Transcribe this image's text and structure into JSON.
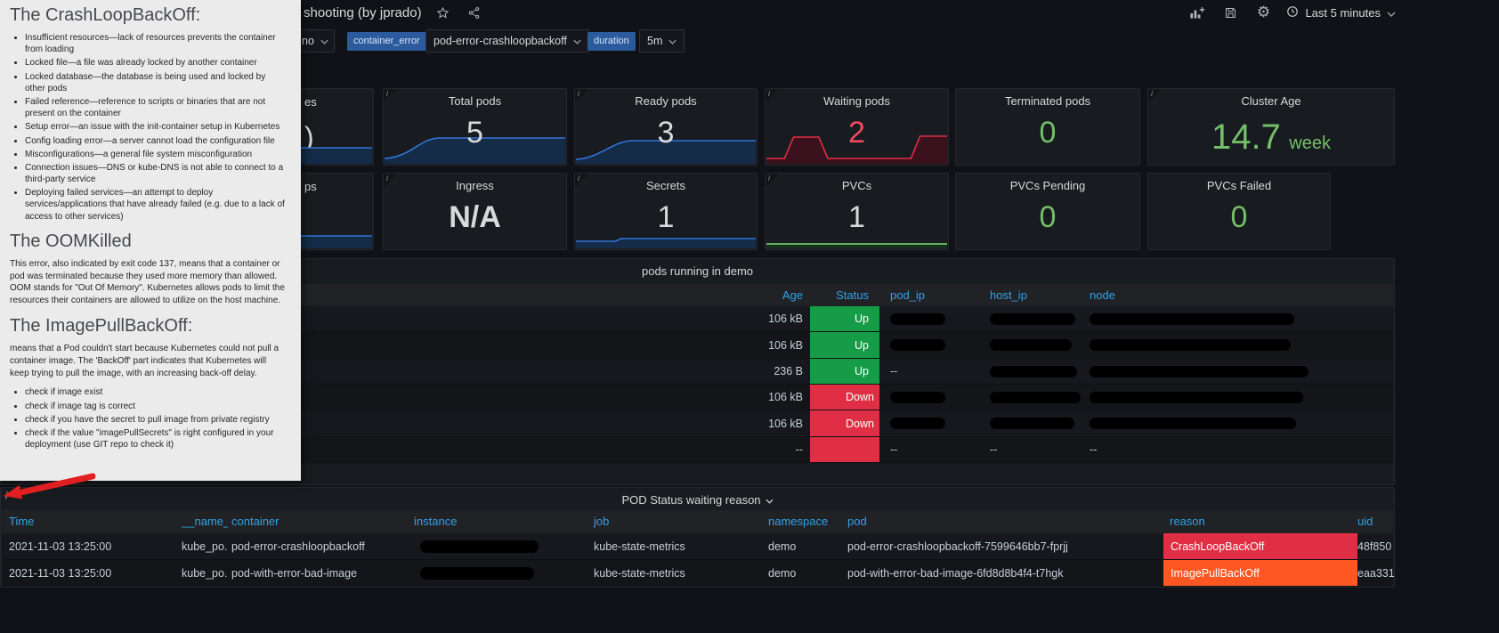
{
  "topbar": {
    "title_fragment": "shooting (by jprado)",
    "time_range": "Last 5 minutes"
  },
  "filter_bar": {
    "namespace_fragment": "no",
    "container_error_label": "container_error",
    "pod_filter_value": "pod-error-crashloopbackoff",
    "duration_label": "duration",
    "duration_value": "5m"
  },
  "tooltip": {
    "crashloop": {
      "heading": "The CrashLoopBackOff:",
      "bullets": [
        "Insufficient resources—lack of resources prevents the container from loading",
        "Locked file—a file was already locked by another container",
        "Locked database—the database is being used and locked by other pods",
        "Failed reference—reference to scripts or binaries that are not present on the container",
        "Setup error—an issue with the init-container setup in Kubernetes",
        "Config loading error—a server cannot load the configuration file",
        "Misconfigurations—a general file system misconfiguration",
        "Connection issues—DNS or kube-DNS is not able to connect to a third-party service",
        "Deploying failed services—an attempt to deploy services/applications that have already failed (e.g. due to a lack of access to other services)"
      ]
    },
    "oomkilled": {
      "heading": "The OOMKilled",
      "paragraph": "This error, also indicated by exit code 137, means that a container or pod was terminated because they used more memory than allowed. OOM stands for \"Out Of Memory\". Kubernetes allows pods to limit the resources their containers are allowed to utilize on the host machine."
    },
    "imagepull": {
      "heading": "The ImagePullBackOff:",
      "paragraph": "means that a Pod couldn't start because Kubernetes could not pull a container image. The 'BackOff' part indicates that Kubernetes will keep trying to pull the image, with an increasing back-off delay.",
      "bullets": [
        "check if image exist",
        "check if image tag is correct",
        "check if you have the secret to pull image from private registry",
        "check if the value \"imagePullSecrets\" is right configured in your deployment (use GIT repo to check it)"
      ]
    }
  },
  "stats": {
    "partial_top": {
      "title_fragment": "es",
      "value_fragment": ")"
    },
    "total_pods": {
      "title": "Total pods",
      "value": "5"
    },
    "ready_pods": {
      "title": "Ready pods",
      "value": "3"
    },
    "waiting_pods": {
      "title": "Waiting pods",
      "value": "2"
    },
    "terminated_pods": {
      "title": "Terminated pods",
      "value": "0"
    },
    "cluster_age": {
      "title": "Cluster Age",
      "value": "14.7",
      "unit": "week"
    },
    "partial_bottom": {
      "title_fragment": "ps"
    },
    "ingress": {
      "title": "Ingress",
      "value": "N/A"
    },
    "secrets": {
      "title": "Secrets",
      "value": "1"
    },
    "pvcs": {
      "title": "PVCs",
      "value": "1"
    },
    "pvcs_pending": {
      "title": "PVCs Pending",
      "value": "0"
    },
    "pvcs_failed": {
      "title": "PVCs Failed",
      "value": "0"
    }
  },
  "pods_table": {
    "title": "pods running in demo",
    "columns": {
      "age": "Age",
      "status": "Status",
      "pod_ip": "pod_ip",
      "host_ip": "host_ip",
      "node": "node"
    },
    "rows": [
      {
        "age": "106 kB",
        "status": "Up"
      },
      {
        "age": "106 kB",
        "status": "Up"
      },
      {
        "age": "236 B",
        "status": "Up",
        "pod_ip": "--"
      },
      {
        "age": "106 kB",
        "status": "Down"
      },
      {
        "age": "106 kB",
        "status": "Down"
      },
      {
        "age": "--",
        "status": "",
        "pod_ip": "--",
        "host_ip": "--",
        "node": "--"
      }
    ]
  },
  "waiting_table": {
    "title": "POD Status waiting reason",
    "columns": {
      "time": "Time",
      "name": "__name__",
      "container": "container",
      "instance": "instance",
      "job": "job",
      "namespace": "namespace",
      "pod": "pod",
      "reason": "reason",
      "uid": "uid"
    },
    "rows": [
      {
        "time": "2021-11-03 13:25:00",
        "name": "kube_po...",
        "container": "pod-error-crashloopbackoff",
        "job": "kube-state-metrics",
        "namespace": "demo",
        "pod": "pod-error-crashloopbackoff-7599646bb7-fprjj",
        "reason": "CrashLoopBackOff",
        "uid": "48f850"
      },
      {
        "time": "2021-11-03 13:25:00",
        "name": "kube_po...",
        "container": "pod-with-error-bad-image",
        "job": "kube-state-metrics",
        "namespace": "demo",
        "pod": "pod-with-error-bad-image-6fd8d8b4f4-t7hgk",
        "reason": "ImagePullBackOff",
        "uid": "eaa331"
      }
    ]
  },
  "icons": {
    "settings_glyph": "⚙",
    "info_glyph": "i"
  },
  "colors": {
    "header_link_blue": "#33a2e5",
    "stat_green": "#73bf69",
    "stat_red": "#f2495c",
    "status_up_bg": "#169c46",
    "status_down_bg": "#e02f44",
    "reason_crashloop_bg": "#e02f44",
    "reason_imagepull_bg": "#ff5722",
    "tag_blue": "#2b5a9d",
    "annotation_arrow_red": "#e02020"
  }
}
